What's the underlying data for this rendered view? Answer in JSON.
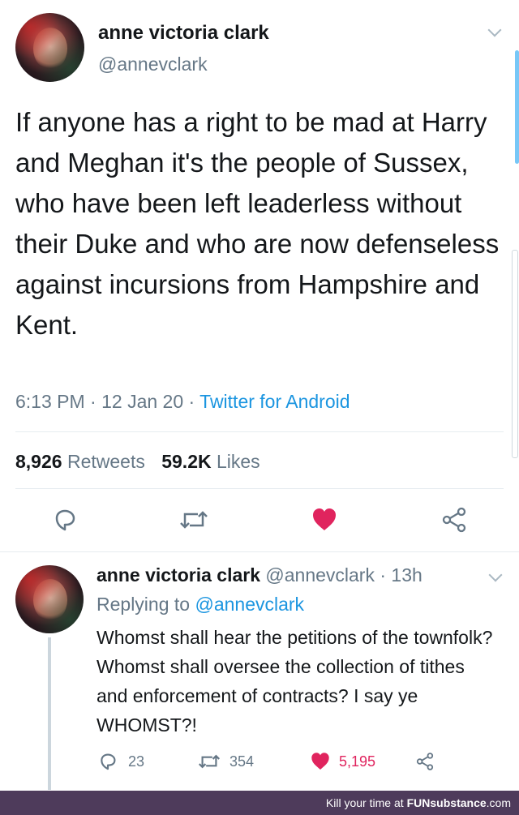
{
  "tweet": {
    "author_name": "anne victoria clark",
    "author_handle": "@annevclark",
    "text": "If anyone has a right to be mad at Harry and Meghan it's the people of Sussex, who have been left leaderless without their Duke and who are now defenseless against incursions from Hampshire and Kent.",
    "time": "6:13 PM",
    "date": "12 Jan 20",
    "source": "Twitter for Android",
    "retweets_count": "8,926",
    "retweets_label": "Retweets",
    "likes_count": "59.2K",
    "likes_label": "Likes"
  },
  "reply": {
    "author_name": "anne victoria clark",
    "author_handle": "@annevclark",
    "age": "13h",
    "replying_prefix": "Replying to",
    "replying_to": "@annevclark",
    "text": "Whomst shall hear the petitions of the townfolk? Whomst shall oversee the collection of tithes and enforcement of contracts? I say ye WHOMST?!",
    "reply_count": "23",
    "retweet_count": "354",
    "like_count": "5,195"
  },
  "footer": {
    "text": "Kill your time at",
    "brand": "FUNsubstance",
    "suffix": ".com"
  },
  "colors": {
    "accent": "#1b95e0",
    "like": "#e0245e",
    "footer_bg": "#4e3b5b"
  }
}
